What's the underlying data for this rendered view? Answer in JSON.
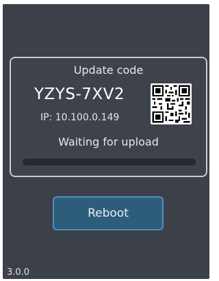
{
  "card": {
    "title": "Update code",
    "code": "YZYS-7XV2",
    "ip": "IP: 10.100.0.149",
    "status": "Waiting for upload",
    "upload_progress": 0
  },
  "reboot_label": "Reboot",
  "version": "3.0.0",
  "colors": {
    "background": "#3b4049",
    "card_border": "#c9ccd3",
    "button_fill": "#2e5d7c",
    "button_border": "#4d92bd",
    "progress_track": "#262a30"
  }
}
